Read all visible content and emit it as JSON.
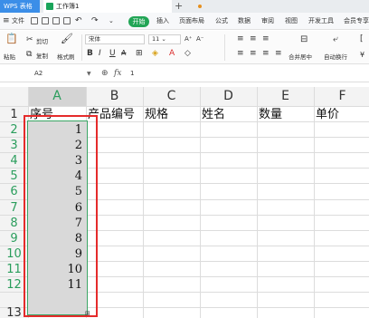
{
  "tabs": {
    "app": "WPS 表格",
    "book": "工作簿1"
  },
  "menu": {
    "file": "文件",
    "items": [
      "开始",
      "插入",
      "页面布局",
      "公式",
      "数据",
      "审阅",
      "视图",
      "开发工具",
      "会员专享"
    ]
  },
  "ribbon": {
    "paste": "粘贴",
    "cut": "剪切",
    "copy": "复制",
    "format_painter": "格式刷",
    "font_name": "宋体",
    "font_size": "11",
    "merge_center": "合并居中",
    "wrap_text": "自动换行"
  },
  "formula_bar": {
    "cell_ref": "A2",
    "value": "1"
  },
  "grid": {
    "columns": [
      "A",
      "B",
      "C",
      "D",
      "E",
      "F"
    ],
    "rows": [
      "1",
      "2",
      "3",
      "4",
      "5",
      "6",
      "7",
      "8",
      "9",
      "10",
      "11",
      "12",
      "13"
    ],
    "headers": [
      "序号",
      "产品编号",
      "规格",
      "姓名",
      "数量",
      "单价"
    ],
    "col_a_values": [
      "1",
      "2",
      "3",
      "4",
      "5",
      "6",
      "7",
      "8",
      "9",
      "10",
      "11"
    ]
  },
  "colors": {
    "accent": "#22a556",
    "highlight": "#e52b2b",
    "selection": "#d9d9d9"
  }
}
